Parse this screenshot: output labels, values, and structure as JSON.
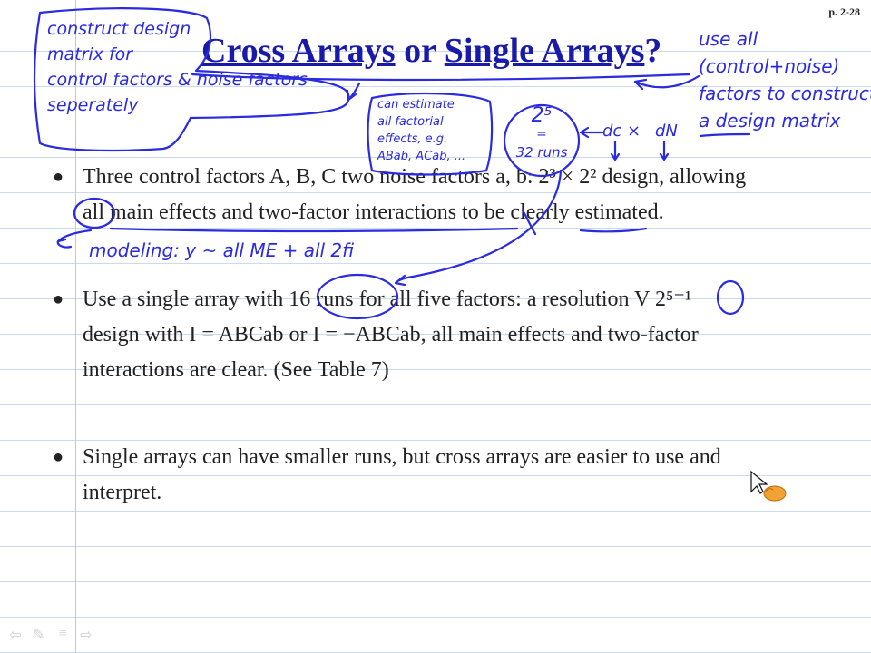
{
  "page_number": "p. 2-28",
  "title": {
    "part1": "Cross Arrays",
    "middle": " or ",
    "part2": "Single Arrays",
    "end": "?"
  },
  "bullets": [
    {
      "line1": "Three control factors A, B, C two noise factors a, b: 2³ × 2² design, allowing",
      "line2": "all main effects and two-factor interactions to be clearly estimated."
    },
    {
      "line1": "Use a single array with 16 runs for all five factors: a resolution V 2⁵⁻¹",
      "line2": "design with I = ABCab or I = −ABCab, all main effects and two-factor",
      "line3": "interactions are clear. (See Table 7)"
    },
    {
      "line1": "Single arrays can have smaller runs, but cross arrays are easier to use and",
      "line2": "interpret."
    }
  ],
  "annotations": {
    "left_box": [
      "construct design",
      "matrix for",
      "control factors & noise factors",
      "seperately"
    ],
    "right_note": [
      "use all",
      "(control+noise)",
      "factors to construct",
      "a design matrix"
    ],
    "estimate_box": [
      "can estimate",
      "all factorial",
      "effects, e.g.",
      "ABab, ACab, ..."
    ],
    "runs_circle": [
      "2⁵",
      "=",
      "32 runs"
    ],
    "dc_dn": [
      "dc ×",
      "dN"
    ],
    "modeling": "modeling: y ~ all ME + all 2fi"
  },
  "colors": {
    "ink": "#2a2ae0",
    "title": "#1a1aa8",
    "rule": "#c9dcee",
    "margin": "#e8b9b9"
  }
}
